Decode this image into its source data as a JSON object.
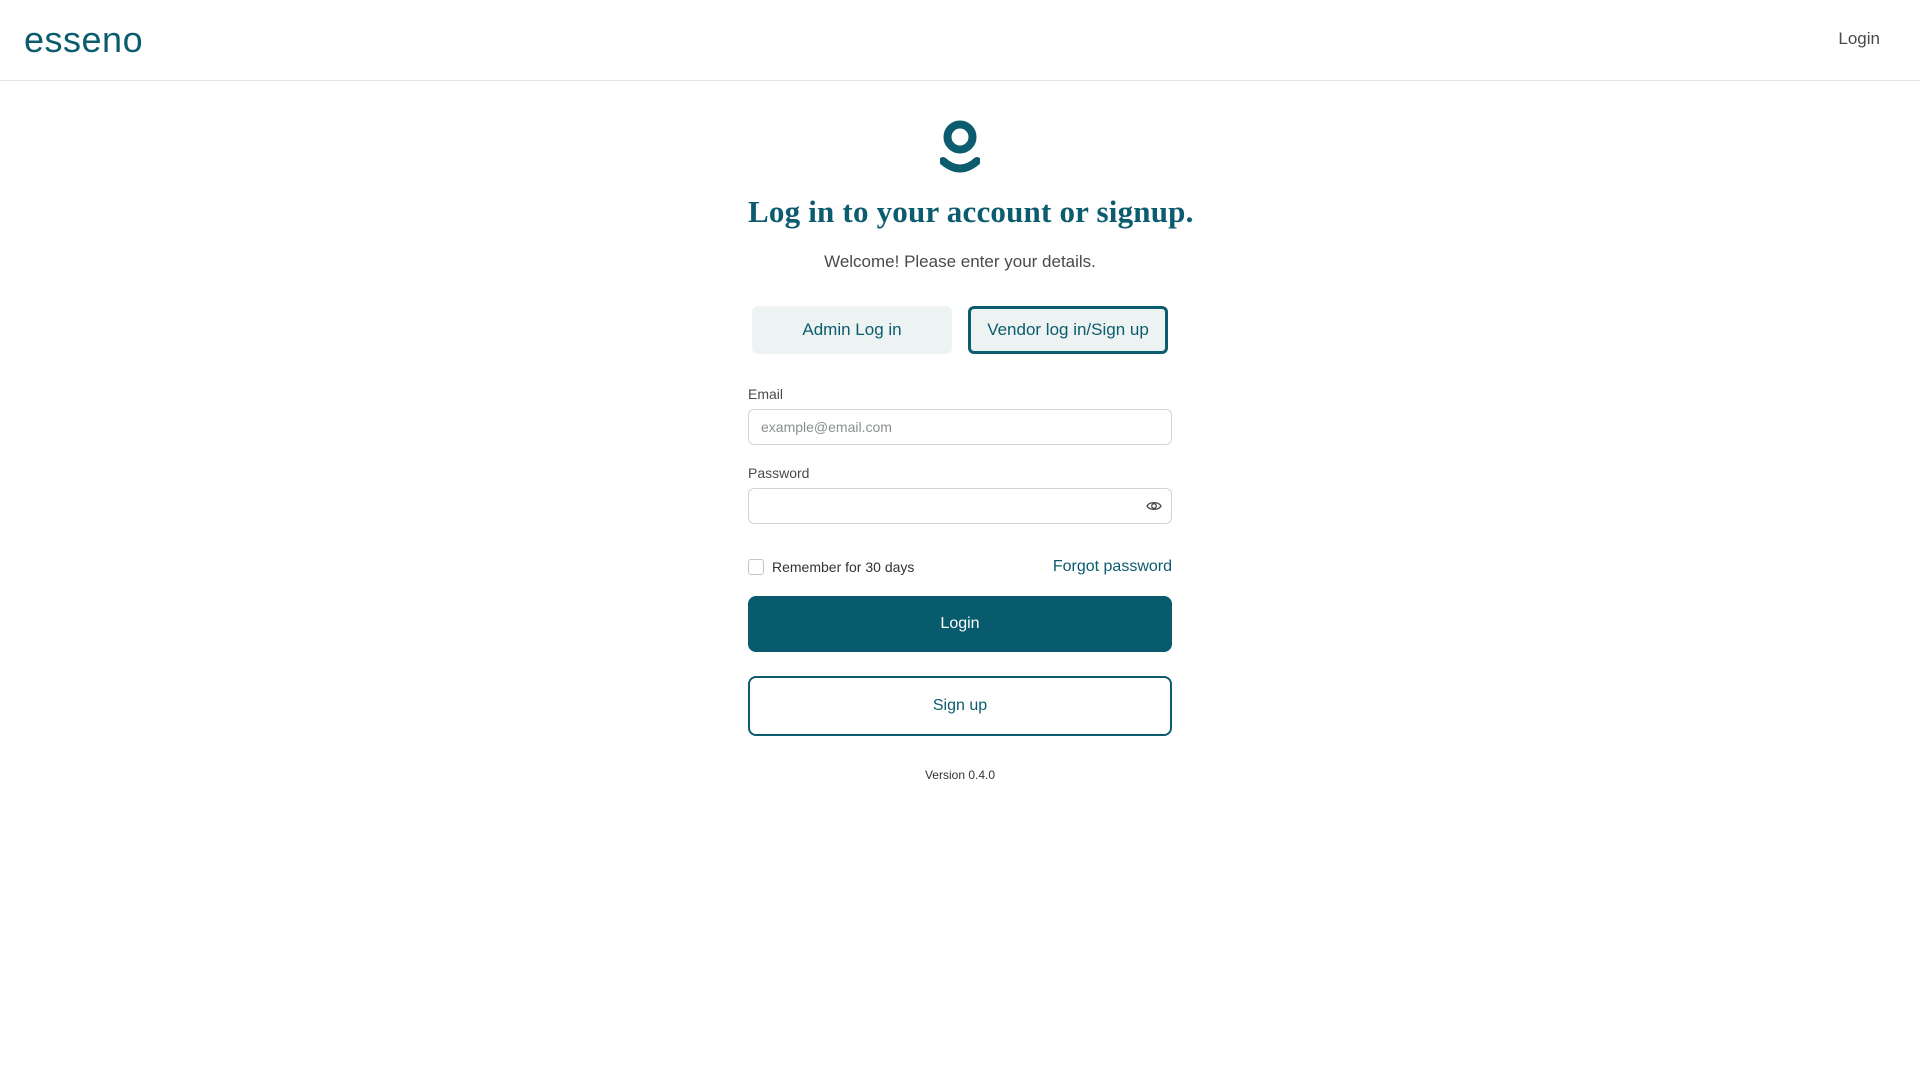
{
  "header": {
    "brand": "esseno",
    "nav_login": "Login"
  },
  "colors": {
    "brand": "#0b5c6e",
    "primary_button": "#075b6d",
    "tab_bg": "#edf2f3"
  },
  "icons": {
    "logo_mark": "logo-mark-icon",
    "password_toggle": "eye-icon"
  },
  "login": {
    "title": "Log in to your account or signup.",
    "subtitle": "Welcome! Please enter your details.",
    "tabs": [
      {
        "label": "Admin Log in",
        "active": false
      },
      {
        "label": "Vendor log in/Sign up",
        "active": true
      }
    ],
    "email": {
      "label": "Email",
      "placeholder": "example@email.com",
      "value": ""
    },
    "password": {
      "label": "Password",
      "value": ""
    },
    "remember_label": "Remember for 30 days",
    "remember_checked": false,
    "forgot_label": "Forgot password",
    "login_button": "Login",
    "signup_button": "Sign up",
    "version": "Version 0.4.0"
  }
}
